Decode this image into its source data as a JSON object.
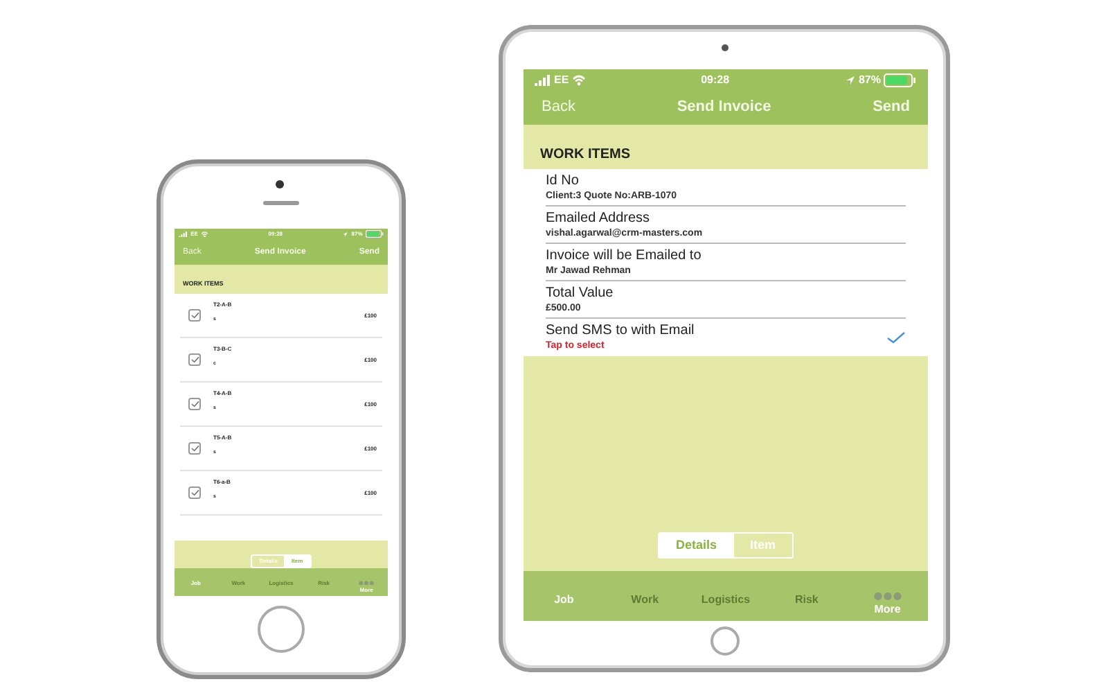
{
  "phone": {
    "status_bar": {
      "carrier": "EE",
      "time": "09:28",
      "battery": "87%"
    },
    "nav": {
      "back": "Back",
      "title": "Send Invoice",
      "action": "Send"
    },
    "section": "WORK ITEMS",
    "items": [
      {
        "name": "T2-A-B",
        "sub": "s",
        "price": "£100",
        "checked": true
      },
      {
        "name": "T3-B-C",
        "sub": "c",
        "price": "£100",
        "checked": true
      },
      {
        "name": "T4-A-B",
        "sub": "s",
        "price": "£100",
        "checked": true
      },
      {
        "name": "T5-A-B",
        "sub": "s",
        "price": "£100",
        "checked": true
      },
      {
        "name": "T6-a-B",
        "sub": "s",
        "price": "£100",
        "checked": true
      }
    ],
    "segments": [
      {
        "label": "Details",
        "selected": false
      },
      {
        "label": "Item",
        "selected": true
      }
    ],
    "tabs": [
      {
        "label": "Job",
        "selected": true,
        "kind": "text"
      },
      {
        "label": "Work",
        "selected": false,
        "kind": "text"
      },
      {
        "label": "Logistics",
        "selected": false,
        "kind": "text"
      },
      {
        "label": "Risk",
        "selected": false,
        "kind": "text"
      },
      {
        "label": "More",
        "kind": "more"
      }
    ]
  },
  "tablet": {
    "status_bar": {
      "carrier": "EE",
      "time": "09:28",
      "battery": "87%"
    },
    "nav": {
      "back": "Back",
      "title": "Send Invoice",
      "action": "Send"
    },
    "section": "WORK ITEMS",
    "fields": [
      {
        "kind": "info",
        "label": "Id No",
        "value": "Client:3 Quote No:ARB-1070"
      },
      {
        "kind": "info",
        "label": "Emailed Address",
        "value": "vishal.agarwal@crm-masters.com"
      },
      {
        "kind": "info",
        "label": "Invoice will be Emailed to",
        "value": "Mr Jawad Rehman"
      },
      {
        "kind": "info",
        "label": "Total Value",
        "value": "£500.00"
      },
      {
        "kind": "toggle",
        "label": "Send SMS to  with Email",
        "value": "Tap to select",
        "checked": true
      }
    ],
    "segments": [
      {
        "label": "Details",
        "selected": true
      },
      {
        "label": "Item",
        "selected": false
      }
    ],
    "tabs": [
      {
        "label": "Job",
        "selected": true,
        "kind": "text"
      },
      {
        "label": "Work",
        "selected": false,
        "kind": "text"
      },
      {
        "label": "Logistics",
        "selected": false,
        "kind": "text"
      },
      {
        "label": "Risk",
        "selected": false,
        "kind": "text"
      },
      {
        "label": "More",
        "kind": "more"
      }
    ]
  }
}
